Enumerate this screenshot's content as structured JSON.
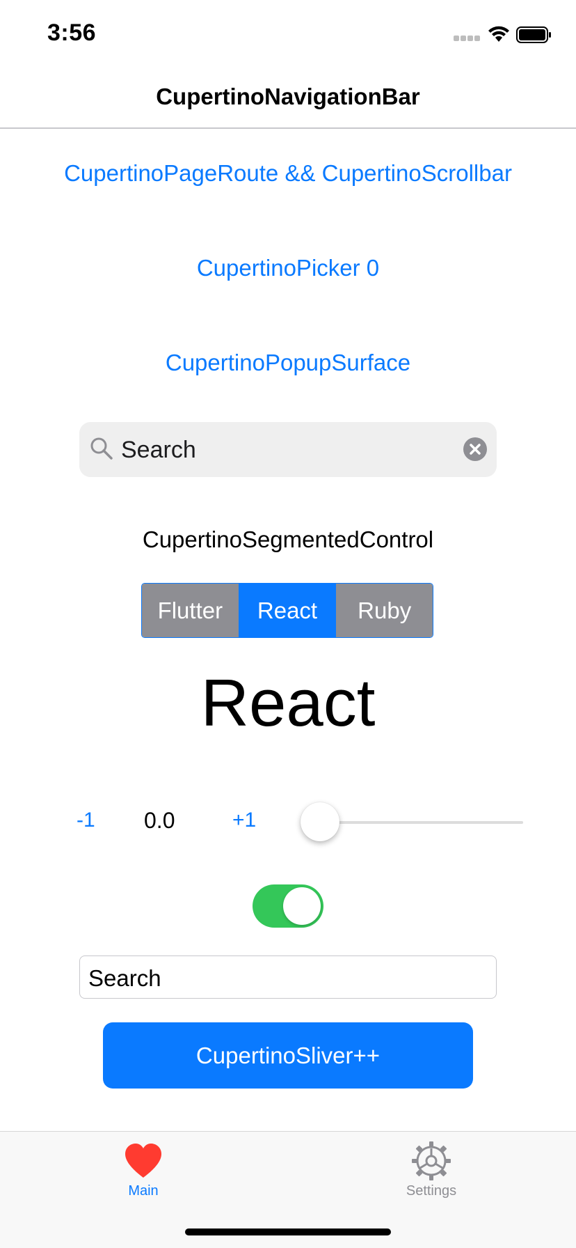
{
  "status_bar": {
    "time": "3:56"
  },
  "nav_bar": {
    "title": "CupertinoNavigationBar"
  },
  "links": {
    "page_route": "CupertinoPageRoute && CupertinoScrollbar",
    "picker": "CupertinoPicker 0",
    "popup_surface": "CupertinoPopupSurface"
  },
  "search_field": {
    "value": "Search",
    "icon": "search-icon",
    "clear_icon": "close-circle-icon"
  },
  "segmented_control": {
    "label": "CupertinoSegmentedControl",
    "options": [
      "Flutter",
      "React",
      "Ruby"
    ],
    "selected": "React",
    "selected_color": "#0A7AFF",
    "unselected_color": "#8E8E93"
  },
  "selected_value": {
    "text": "React"
  },
  "slider_row": {
    "minus_label": "-1",
    "value_label": "0.0",
    "plus_label": "+1",
    "slider_value": 0.0
  },
  "switch": {
    "on": true,
    "color": "#34C759"
  },
  "text_field": {
    "value": "Search"
  },
  "primary_button": {
    "label": "CupertinoSliver++",
    "color": "#0A7AFF"
  },
  "tab_bar": {
    "items": [
      {
        "label": "Main",
        "icon": "heart-icon",
        "active": true
      },
      {
        "label": "Settings",
        "icon": "gear-icon",
        "active": false
      }
    ]
  }
}
